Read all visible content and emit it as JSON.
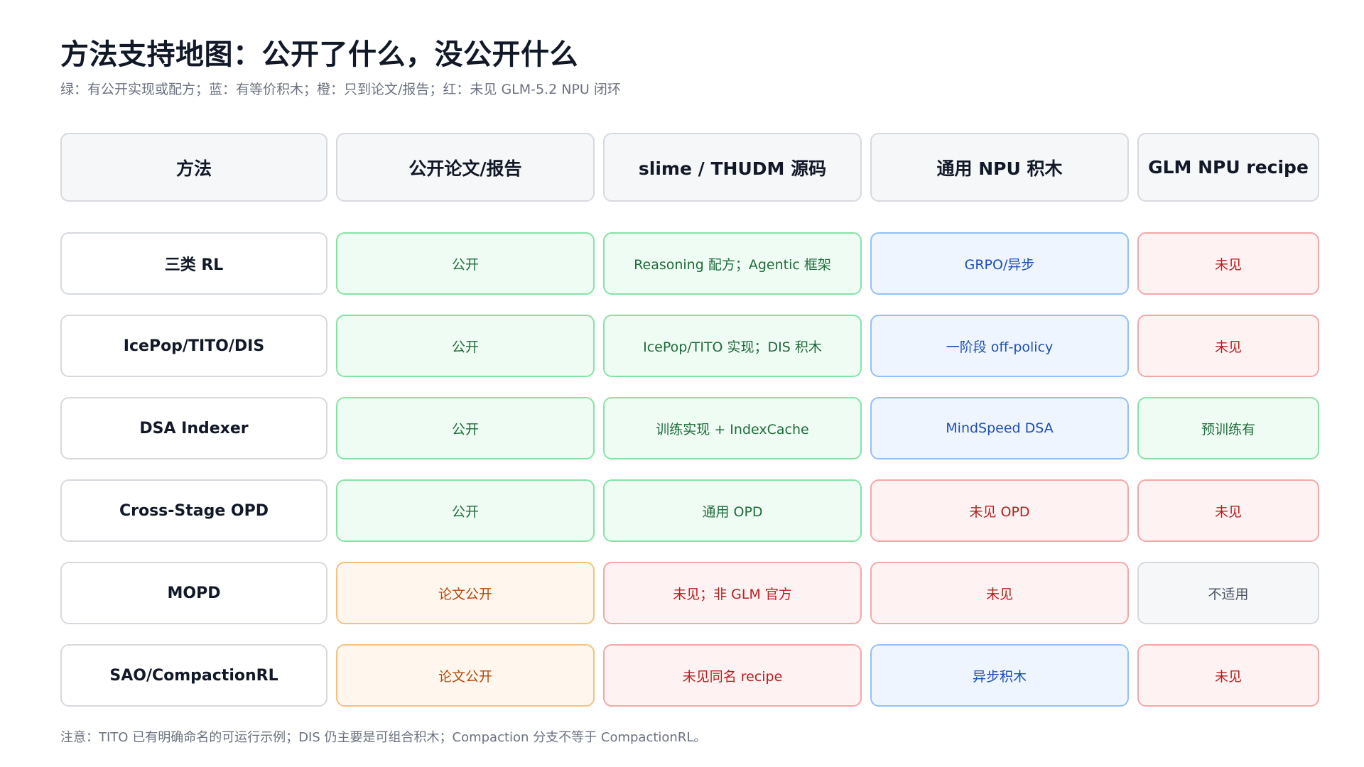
{
  "title": "方法支持地图：公开了什么，没公开什么",
  "subtitle": "绿：有公开实现或配方；蓝：有等价积木；橙：只到论文/报告；红：未见 GLM-5.2 NPU 闭环",
  "colors": {
    "green": "#effcf3",
    "blue": "#eef5ff",
    "orange": "#fff7ed",
    "red": "#fff2f2",
    "gray": "#f6f7f9"
  },
  "headers": [
    "方法",
    "公开论文/报告",
    "slime / THUDM 源码",
    "通用 NPU 积木",
    "GLM NPU recipe"
  ],
  "rows": [
    {
      "method": "三类 RL",
      "cells": [
        {
          "text": "公开",
          "status": "green"
        },
        {
          "text": "Reasoning 配方；Agentic 框架",
          "status": "green"
        },
        {
          "text": "GRPO/异步",
          "status": "blue"
        },
        {
          "text": "未见",
          "status": "red"
        }
      ]
    },
    {
      "method": "IcePop/TITO/DIS",
      "cells": [
        {
          "text": "公开",
          "status": "green"
        },
        {
          "text": "IcePop/TITO 实现；DIS 积木",
          "status": "green"
        },
        {
          "text": "一阶段 off-policy",
          "status": "blue"
        },
        {
          "text": "未见",
          "status": "red"
        }
      ]
    },
    {
      "method": "DSA Indexer",
      "cells": [
        {
          "text": "公开",
          "status": "green"
        },
        {
          "text": "训练实现 + IndexCache",
          "status": "green"
        },
        {
          "text": "MindSpeed DSA",
          "status": "blue"
        },
        {
          "text": "预训练有",
          "status": "green"
        }
      ]
    },
    {
      "method": "Cross-Stage OPD",
      "cells": [
        {
          "text": "公开",
          "status": "green"
        },
        {
          "text": "通用 OPD",
          "status": "green"
        },
        {
          "text": "未见 OPD",
          "status": "red"
        },
        {
          "text": "未见",
          "status": "red"
        }
      ]
    },
    {
      "method": "MOPD",
      "cells": [
        {
          "text": "论文公开",
          "status": "orange"
        },
        {
          "text": "未见；非 GLM 官方",
          "status": "red"
        },
        {
          "text": "未见",
          "status": "red"
        },
        {
          "text": "不适用",
          "status": "gray"
        }
      ]
    },
    {
      "method": "SAO/CompactionRL",
      "cells": [
        {
          "text": "论文公开",
          "status": "orange"
        },
        {
          "text": "未见同名 recipe",
          "status": "red"
        },
        {
          "text": "异步积木",
          "status": "blue"
        },
        {
          "text": "未见",
          "status": "red"
        }
      ]
    }
  ],
  "note": "注意：TITO 已有明确命名的可运行示例；DIS 仍主要是可组合积木；Compaction 分支不等于 CompactionRL。"
}
